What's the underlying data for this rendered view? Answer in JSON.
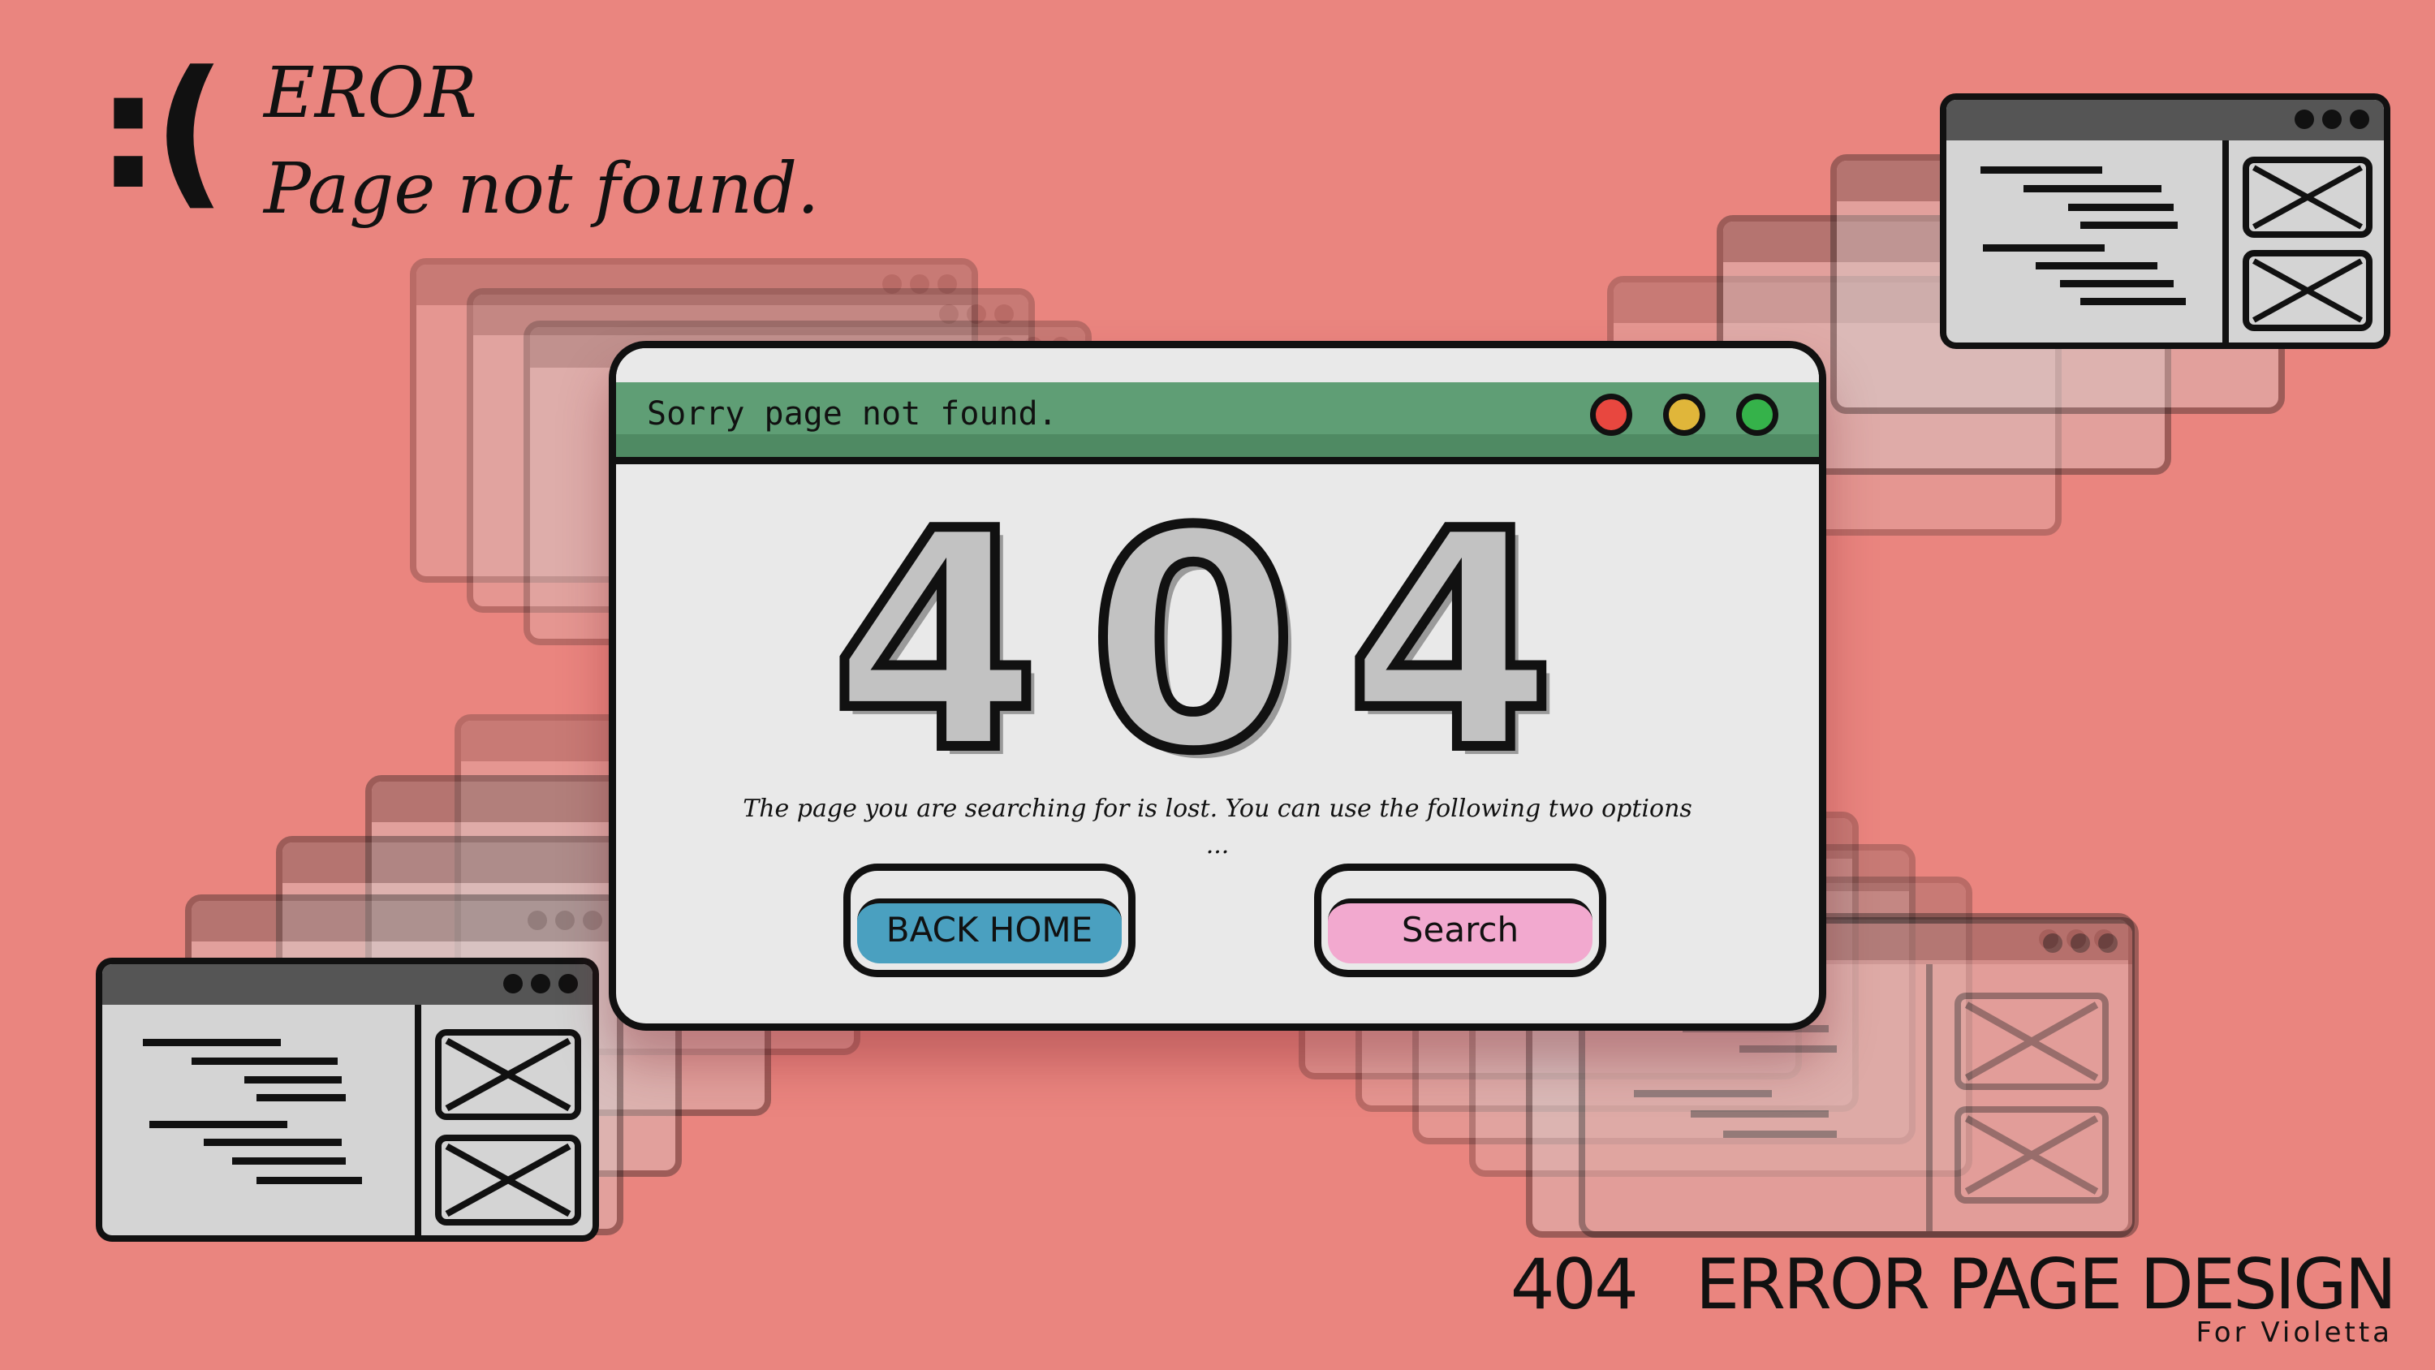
{
  "corner": {
    "face": ":(",
    "title": "EROR",
    "subtitle": "Page not found."
  },
  "dialog": {
    "title": "Sorry page not found.",
    "code": "404",
    "description_line1": "The page you are searching for is lost. You can use the following two options",
    "description_line2": "...",
    "buttons": {
      "back_home": "BACK  HOME",
      "search": "Search"
    },
    "controls": {
      "close_color": "#e8473f",
      "minimize_color": "#e0b63a",
      "maximize_color": "#35b24a"
    }
  },
  "caption": {
    "title": "404   ERROR PAGE DESIGN",
    "subtitle": "For Violetta"
  },
  "colors": {
    "background": "#ea857f",
    "titlebar": "#5f9e75",
    "back_home": "#4aa0c0",
    "search": "#f2a9cf"
  },
  "icons": [
    "sad-face-icon",
    "window-dots-icon",
    "image-placeholder-icon"
  ]
}
